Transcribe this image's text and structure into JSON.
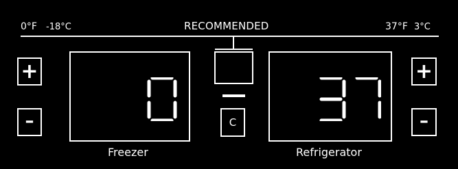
{
  "scale": {
    "left_f": "0°F",
    "left_c": "-18°C",
    "center": "RECOMMENDED",
    "right_f": "37°F",
    "right_c": "3°C"
  },
  "freezer": {
    "plus_label": "+",
    "minus_label": "–",
    "value": "0",
    "caption": "Freezer"
  },
  "refrigerator": {
    "plus_label": "+",
    "minus_label": "–",
    "value": "37",
    "caption": "Refrigerator"
  },
  "center_panel": {
    "unit_button": "C"
  },
  "colors": {
    "background": "#000000",
    "foreground": "#ffffff"
  }
}
